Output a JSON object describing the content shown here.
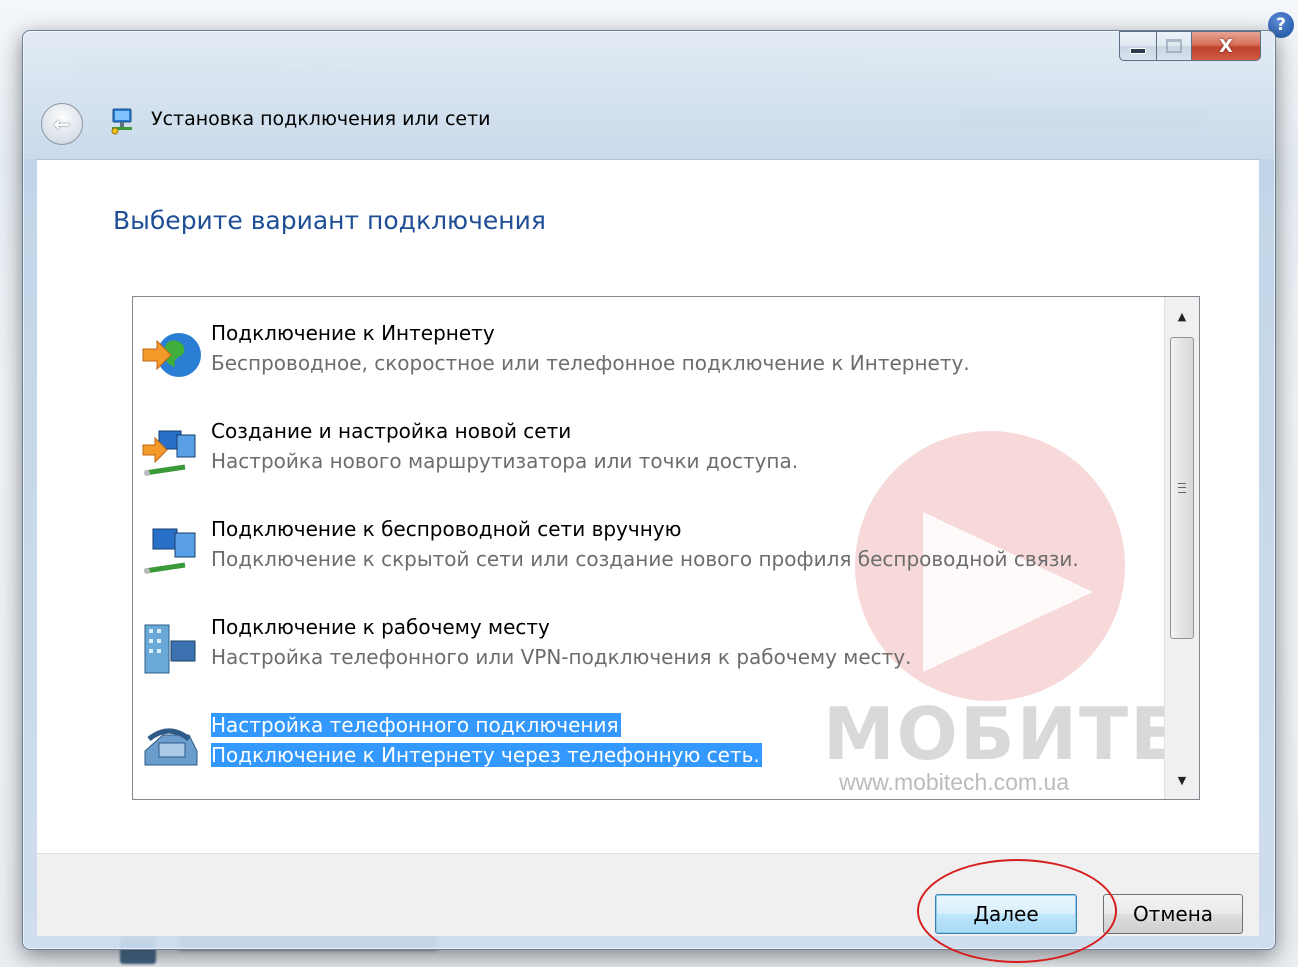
{
  "window": {
    "title": "Установка подключения или сети",
    "caption": {
      "minimize": "minimize",
      "maximize": "maximize",
      "close": "X"
    }
  },
  "page": {
    "heading": "Выберите вариант подключения"
  },
  "options": [
    {
      "title": "Подключение к Интернету",
      "description": "Беспроводное, скоростное или телефонное подключение к Интернету.",
      "icon": "globe-icon",
      "selected": false
    },
    {
      "title": "Создание и настройка новой сети",
      "description": "Настройка нового маршрутизатора или точки доступа.",
      "icon": "new-network-icon",
      "selected": false
    },
    {
      "title": "Подключение к беспроводной сети вручную",
      "description": "Подключение к скрытой сети или создание нового профиля беспроводной связи.",
      "icon": "wireless-network-icon",
      "selected": false
    },
    {
      "title": "Подключение к рабочему месту",
      "description": "Настройка телефонного или VPN-подключения к рабочему месту.",
      "icon": "workplace-icon",
      "selected": false
    },
    {
      "title": "Настройка телефонного подключения",
      "description": "Подключение к Интернету через телефонную сеть.",
      "icon": "telephone-icon",
      "selected": true
    }
  ],
  "watermark": {
    "brand": "МОБИТЕК",
    "url": "www.mobitech.com.ua"
  },
  "buttons": {
    "next": "Далее",
    "cancel": "Отмена"
  },
  "background": {
    "help": "?"
  },
  "colors": {
    "heading": "#1e4e96",
    "selection": "#3399ff",
    "annotation": "#d61e1e"
  }
}
